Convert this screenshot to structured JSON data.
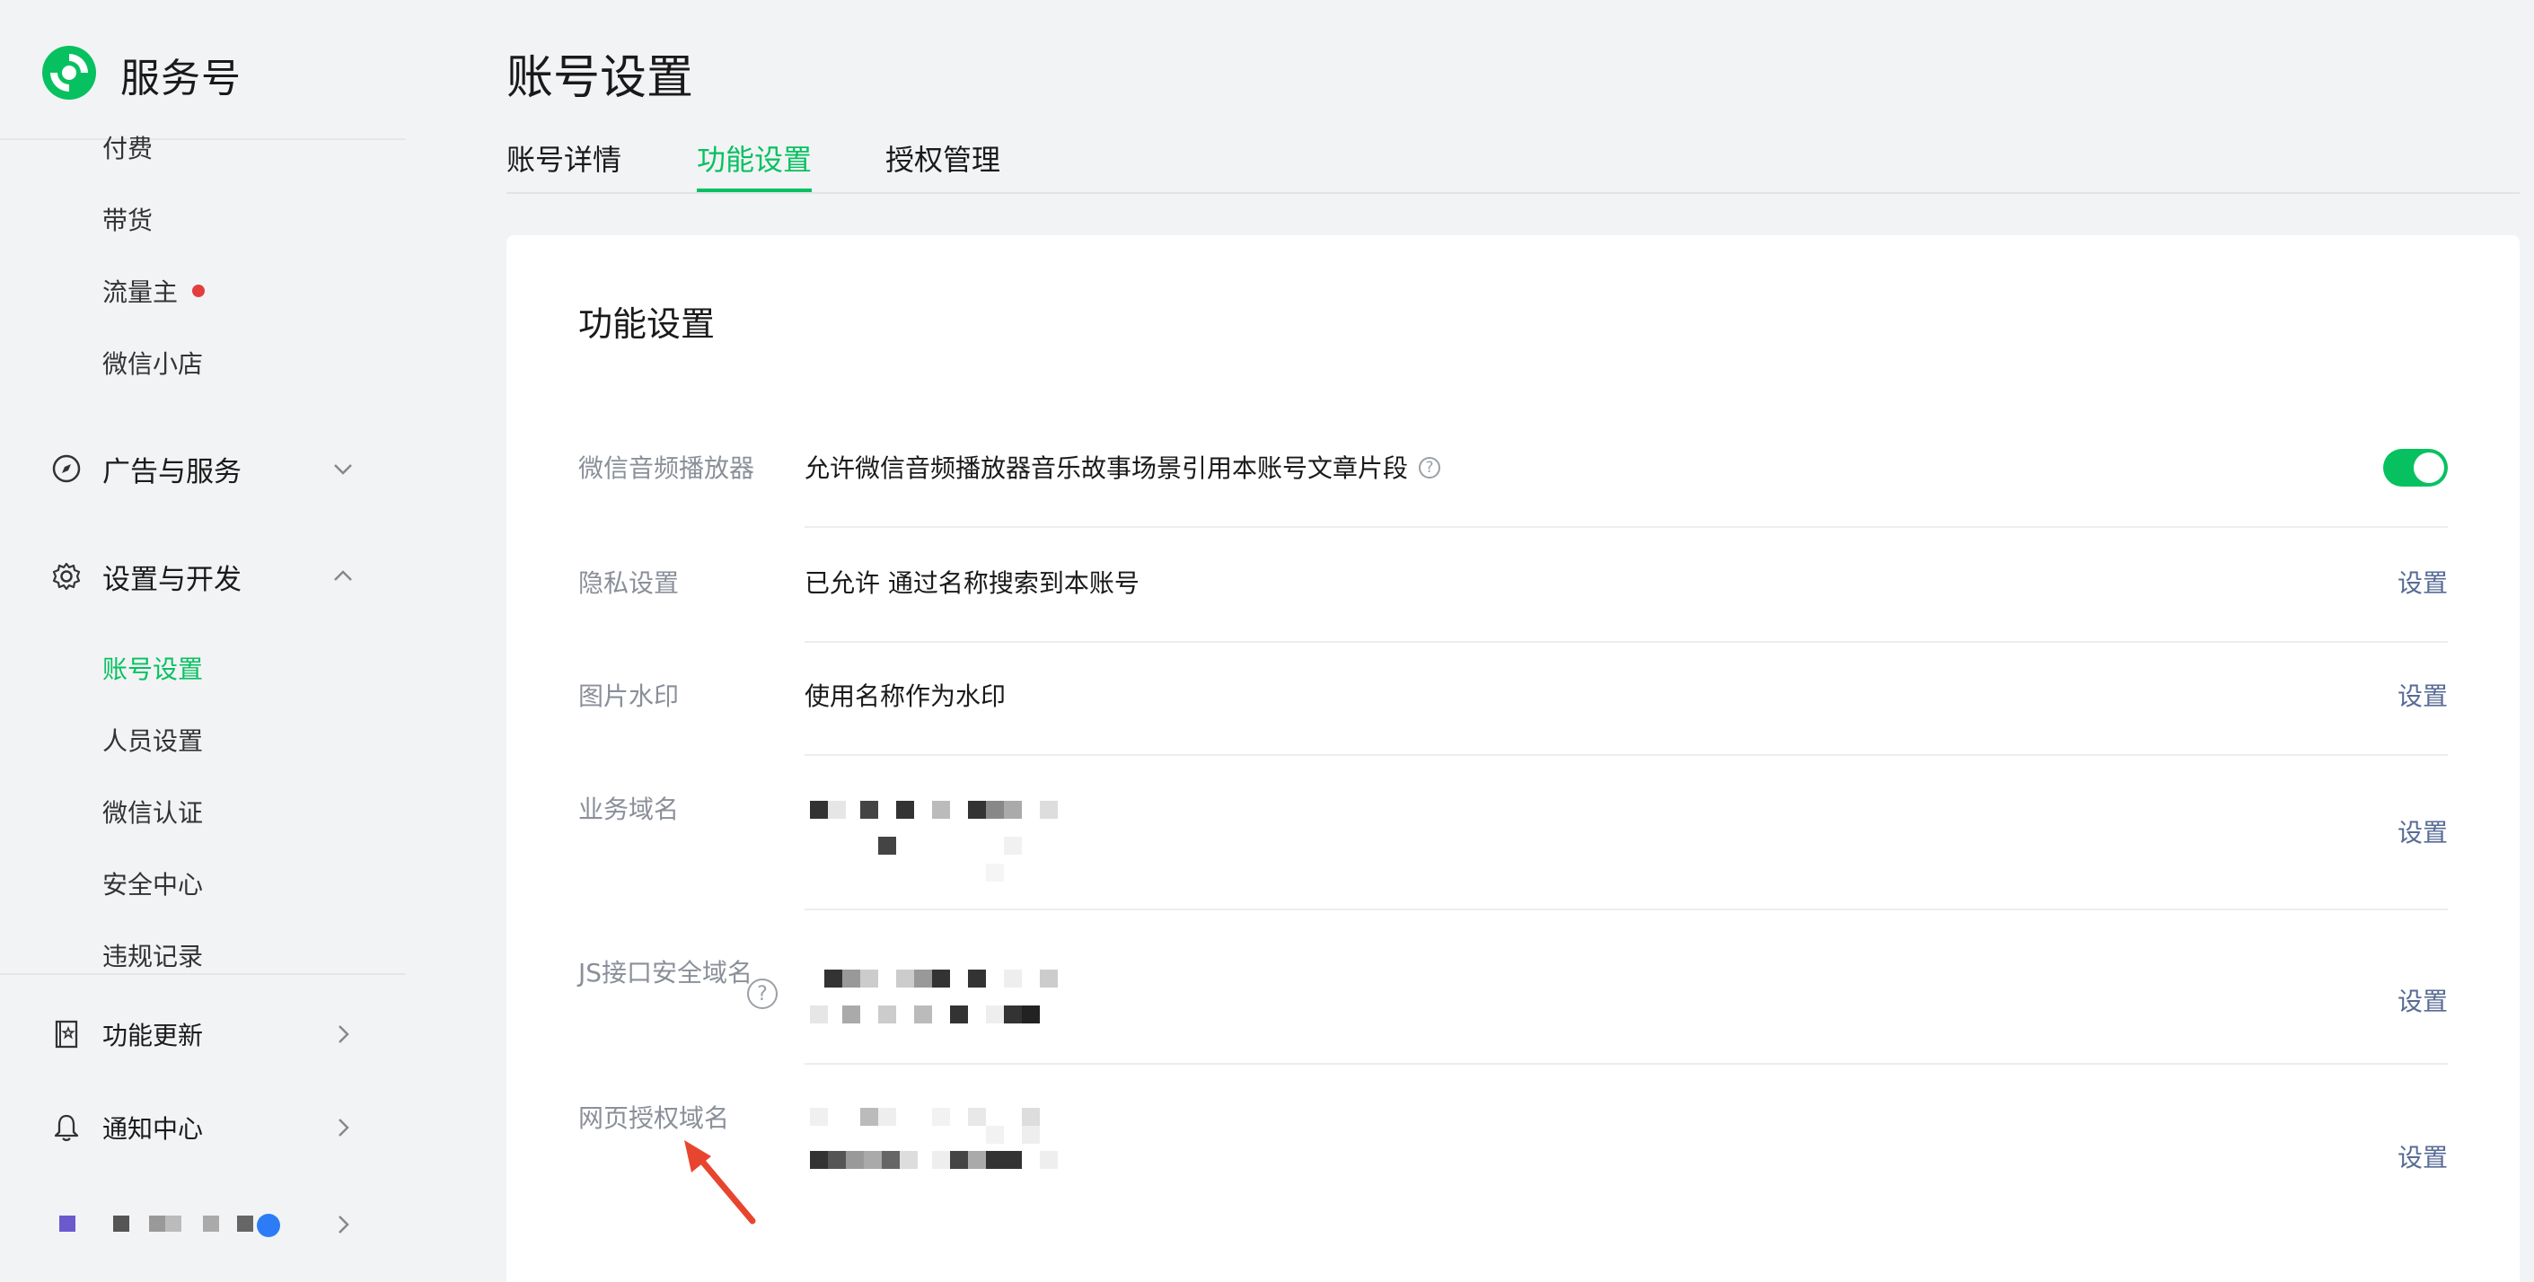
{
  "app": {
    "brand_name": "服务号"
  },
  "sidebar": {
    "sub_items_top": [
      {
        "label": "付费"
      },
      {
        "label": "带货"
      },
      {
        "label": "流量主",
        "has_dot": true
      },
      {
        "label": "微信小店"
      }
    ],
    "groups": [
      {
        "label": "广告与服务",
        "icon": "compass-icon",
        "expanded": false
      },
      {
        "label": "设置与开发",
        "icon": "gear-icon",
        "expanded": true
      }
    ],
    "settings_items": [
      {
        "label": "账号设置",
        "active": true
      },
      {
        "label": "人员设置"
      },
      {
        "label": "微信认证"
      },
      {
        "label": "安全中心"
      },
      {
        "label": "违规记录"
      }
    ],
    "bottom_items": [
      {
        "label": "功能更新",
        "icon": "notebook-star-icon"
      },
      {
        "label": "通知中心",
        "icon": "bell-icon"
      }
    ]
  },
  "main": {
    "page_title": "账号设置",
    "tabs": [
      {
        "label": "账号详情"
      },
      {
        "label": "功能设置",
        "active": true
      },
      {
        "label": "授权管理"
      }
    ],
    "card_title": "功能设置",
    "rows": [
      {
        "label": "微信音频播放器",
        "value": "允许微信音频播放器音乐故事场景引用本账号文章片段",
        "toggle_on": true
      },
      {
        "label": "隐私设置",
        "value": "已允许 通过名称搜索到本账号",
        "action": "设置"
      },
      {
        "label": "图片水印",
        "value": "使用名称作为水印",
        "action": "设置"
      },
      {
        "label": "业务域名",
        "action": "设置"
      },
      {
        "label": "JS接口安全域名",
        "action": "设置"
      },
      {
        "label": "网页授权域名",
        "action": "设置"
      }
    ]
  },
  "colors": {
    "accent_green": "#07c160",
    "link_blue": "#576b95",
    "annotation_arrow": "#e8452f",
    "notify_dot": "#e33e3e"
  }
}
